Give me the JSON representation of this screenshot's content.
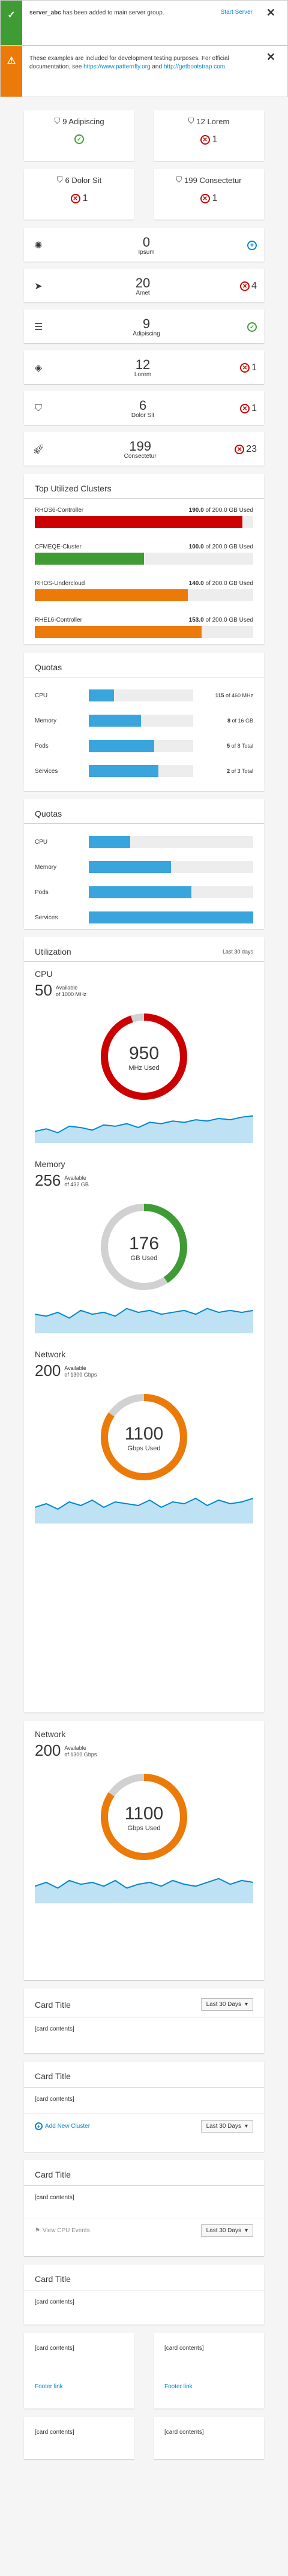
{
  "alerts": {
    "success": {
      "strong": "server_abc",
      "text": " has been added to main server group.",
      "link": "Start Server",
      "icon": "check-icon"
    },
    "warning": {
      "text": "These examples are included for development testing purposes. For official documentation, see ",
      "link1": "https://www.patternfly.org",
      "mid": " and ",
      "link2": "http://getbootstrap.com",
      "end": ".",
      "icon": "warning-icon"
    }
  },
  "agg_top": [
    {
      "title": "9 Adipiscing",
      "icon": "shield-icon",
      "status": "ok",
      "count": ""
    },
    {
      "title": "12 Lorem",
      "icon": "shield-icon",
      "status": "error",
      "count": "1"
    },
    {
      "title": "6 Dolor Sit",
      "icon": "shield-icon",
      "status": "error",
      "count": "1"
    },
    {
      "title": "199 Consectetur",
      "icon": "shield-icon",
      "status": "error",
      "count": "1"
    }
  ],
  "mini_cards": [
    {
      "num": "0",
      "label": "Ipsum",
      "icon": "rebel-icon",
      "status": "add",
      "count": ""
    },
    {
      "num": "20",
      "label": "Amet",
      "icon": "paper-plane-icon",
      "status": "error",
      "count": "4"
    },
    {
      "num": "9",
      "label": "Adipiscing",
      "icon": "database-icon",
      "status": "ok",
      "count": ""
    },
    {
      "num": "12",
      "label": "Lorem",
      "icon": "layers-icon",
      "status": "error",
      "count": "1"
    },
    {
      "num": "6",
      "label": "Dolor Sit",
      "icon": "shield-icon",
      "status": "error",
      "count": "1"
    },
    {
      "num": "199",
      "label": "Consectetur",
      "icon": "rocket-icon",
      "status": "error",
      "count": "23"
    }
  ],
  "top_utilized": {
    "title": "Top Utilized Clusters",
    "rows": [
      {
        "name": "RHOS6-Controller",
        "used": "190.0",
        "of": "of 200.0 GB",
        "suffix": "Used",
        "pct": 95,
        "color": "#cc0000"
      },
      {
        "name": "CFMEQE-Cluster",
        "used": "100.0",
        "of": "of 200.0 GB",
        "suffix": "Used",
        "pct": 50,
        "color": "#3f9c35"
      },
      {
        "name": "RHOS-Undercloud",
        "used": "140.0",
        "of": "of 200.0 GB",
        "suffix": "Used",
        "pct": 70,
        "color": "#ec7a08"
      },
      {
        "name": "RHEL6-Controller",
        "used": "153.0",
        "of": "of 200.0 GB",
        "suffix": "Used",
        "pct": 76.5,
        "color": "#ec7a08"
      }
    ]
  },
  "quotas1": {
    "title": "Quotas",
    "rows": [
      {
        "label": "CPU",
        "pct": 24,
        "used": "115",
        "total": "of 460 MHz"
      },
      {
        "label": "Memory",
        "pct": 50,
        "used": "8",
        "total": "of 16 GB"
      },
      {
        "label": "Pods",
        "pct": 62.5,
        "used": "5",
        "total": "of 8 Total"
      },
      {
        "label": "Services",
        "pct": 66.7,
        "used": "2",
        "total": "of 3 Total"
      }
    ]
  },
  "quotas2": {
    "title": "Quotas",
    "rows": [
      {
        "label": "CPU",
        "pct": 25
      },
      {
        "label": "Memory",
        "pct": 50
      },
      {
        "label": "Pods",
        "pct": 62.5
      },
      {
        "label": "Services",
        "pct": 100
      }
    ]
  },
  "utilization": {
    "title": "Utilization",
    "range": "Last 30 days",
    "sections": [
      {
        "title": "CPU",
        "avail": "50",
        "avail_label": "Available",
        "of": "of 1000 MHz",
        "donut_value": "950",
        "donut_unit": "MHz Used",
        "pct": 95,
        "color": "#cc0000",
        "spark": [
          10,
          12,
          9,
          14,
          13,
          11,
          15,
          14,
          16,
          13,
          17,
          16,
          18,
          17,
          19,
          18,
          20,
          19,
          21,
          22
        ]
      },
      {
        "title": "Memory",
        "avail": "256",
        "avail_label": "Available",
        "of": "of 432 GB",
        "donut_value": "176",
        "donut_unit": "GB Used",
        "pct": 40.7,
        "color": "#3f9c35",
        "spark": [
          14,
          13,
          15,
          12,
          16,
          14,
          15,
          13,
          17,
          15,
          16,
          14,
          15,
          16,
          14,
          17,
          15,
          16,
          15,
          16
        ]
      },
      {
        "title": "Network",
        "avail": "200",
        "avail_label": "Available",
        "of": "of 1300 Gbps",
        "donut_value": "1100",
        "donut_unit": "Gbps Used",
        "pct": 84.6,
        "color": "#ec7a08",
        "spark": [
          12,
          14,
          11,
          15,
          13,
          16,
          12,
          15,
          14,
          13,
          16,
          12,
          15,
          14,
          17,
          13,
          16,
          14,
          15,
          17
        ]
      }
    ]
  },
  "network_standalone": {
    "title": "Network",
    "avail": "200",
    "avail_label": "Available",
    "of": "of 1300 Gbps",
    "donut_value": "1100",
    "donut_unit": "Gbps Used",
    "pct": 84.6,
    "color": "#ec7a08",
    "spark": [
      13,
      15,
      12,
      16,
      14,
      15,
      13,
      16,
      12,
      14,
      15,
      13,
      16,
      14,
      13,
      15,
      17,
      14,
      16,
      15
    ]
  },
  "card_titles": [
    {
      "title": "Card Title",
      "select": "Last 30 Days",
      "body": "[card contents]",
      "footer": "",
      "footer_select": ""
    },
    {
      "title": "Card Title",
      "select": "",
      "body": "[card contents]",
      "footer": "Add New Cluster",
      "footer_select": "Last 30 Days"
    },
    {
      "title": "Card Title",
      "select": "",
      "body": "[card contents]",
      "footer": "View CPU Events",
      "footer_select": "Last 30 Days"
    },
    {
      "title": "Card Title",
      "select": "",
      "body": "[card contents]",
      "footer": "",
      "footer_select": ""
    }
  ],
  "bottom_cards": [
    {
      "body": "[card contents]",
      "footer": "Footer link"
    },
    {
      "body": "[card contents]",
      "footer": "Footer link"
    },
    {
      "body": "[card contents]",
      "footer": ""
    },
    {
      "body": "[card contents]",
      "footer": ""
    }
  ]
}
